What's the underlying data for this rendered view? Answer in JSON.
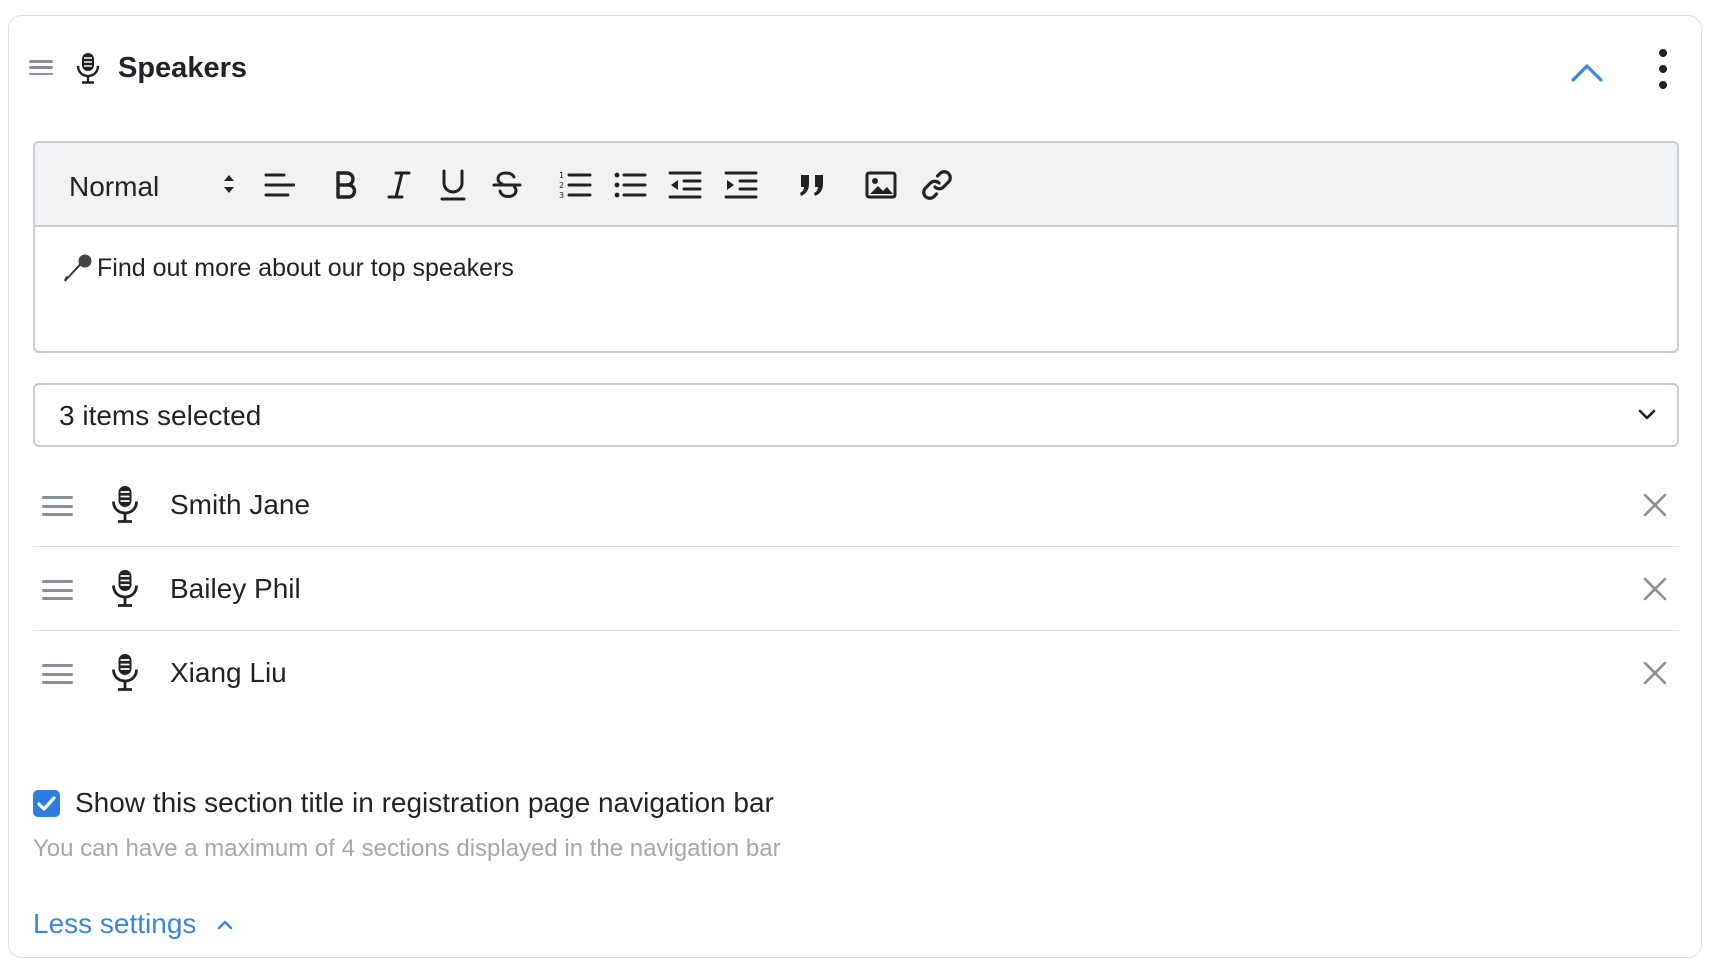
{
  "section": {
    "title": "Speakers",
    "icon": "microphone-icon"
  },
  "editor": {
    "format_label": "Normal",
    "tools": [
      "align-left",
      "bold",
      "italic",
      "underline",
      "strikethrough",
      "ordered-list",
      "bullet-list",
      "outdent",
      "indent",
      "blockquote",
      "image",
      "link"
    ],
    "content_text": "Find out more about our top speakers",
    "content_emoji": "microphone-emoji"
  },
  "speakers_select": {
    "value": "3 items selected"
  },
  "speakers": [
    {
      "name": "Smith Jane"
    },
    {
      "name": "Bailey Phil"
    },
    {
      "name": "Xiang Liu"
    }
  ],
  "nav_option": {
    "checked": true,
    "label": "Show this section title in registration page navigation bar",
    "hint": "You can have a maximum of 4 sections displayed in the navigation bar"
  },
  "settings_toggle": {
    "label": "Less settings"
  },
  "colors": {
    "accent": "#3a86e0",
    "checkbox": "#2f7de1",
    "border": "#c9ccd2",
    "toolbar_bg": "#f1f2f4",
    "hint_text": "#a3a8b0"
  }
}
